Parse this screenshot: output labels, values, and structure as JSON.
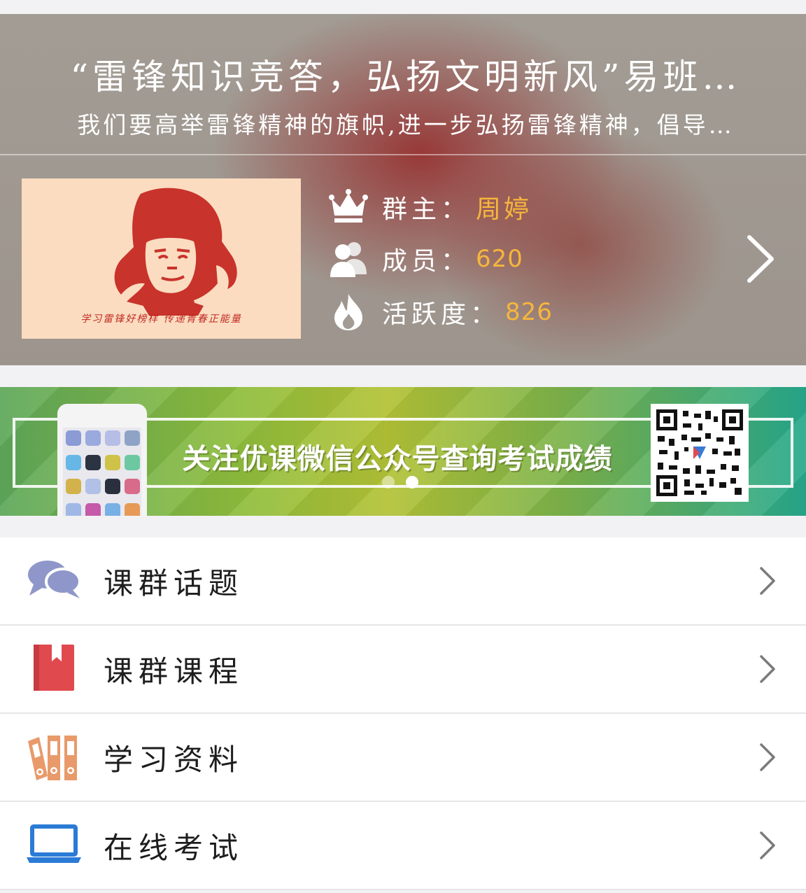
{
  "group": {
    "title": "“雷锋知识竞答，弘扬文明新风”易班…",
    "description": "我们要高举雷锋精神的旗帜,进一步弘扬雷锋精神，倡导…",
    "cover_caption": "学习雷锋好榜样 传递青春正能量",
    "owner_label": "群主：",
    "owner_value": "周婷",
    "members_label": "成员：",
    "members_value": "620",
    "activity_label": "活跃度：",
    "activity_value": "826"
  },
  "banner": {
    "text": "关注优课微信公众号查询考试成绩",
    "slides": 2,
    "active_slide": 2
  },
  "menu": {
    "items": [
      {
        "label": "课群话题",
        "icon": "chat-bubbles-icon"
      },
      {
        "label": "课群课程",
        "icon": "book-icon"
      },
      {
        "label": "学习资料",
        "icon": "binders-icon"
      },
      {
        "label": "在线考试",
        "icon": "laptop-icon"
      }
    ]
  },
  "colors": {
    "accent_value": "#f6b63b",
    "chat_icon": "#8f96c9",
    "book_icon": "#e04a4f",
    "binder_icon": "#e89a6a",
    "laptop_icon": "#2b7bd6"
  }
}
